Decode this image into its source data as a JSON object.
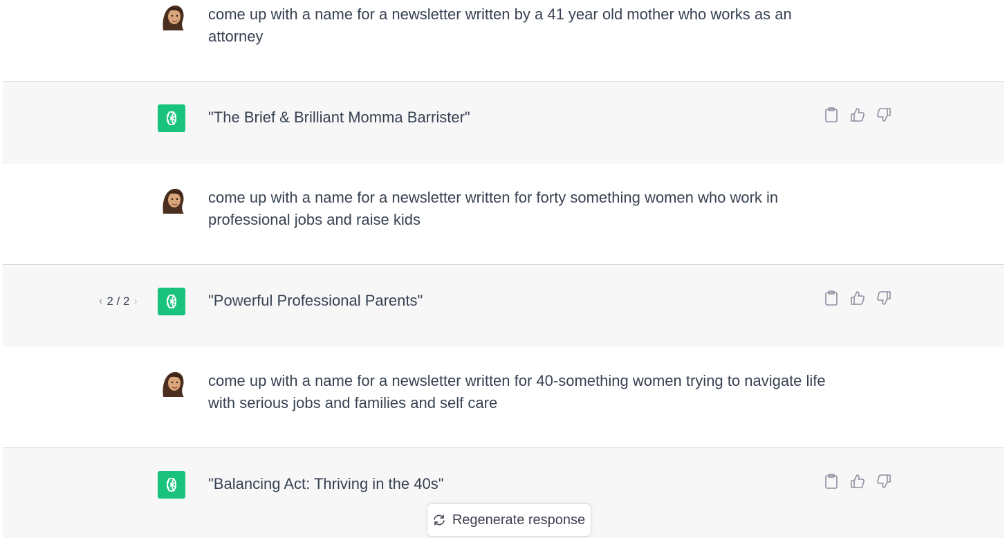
{
  "conversation": [
    {
      "role": "user",
      "text": "come up with a name for a newsletter written by a 41 year old mother who works as an\nattorney"
    },
    {
      "role": "assistant",
      "text": "\"The Brief & Brilliant Momma Barrister\""
    },
    {
      "role": "user",
      "text": "come up with a name for a newsletter written for forty something women who work in\nprofessional jobs and raise kids"
    },
    {
      "role": "assistant",
      "text": "\"Powerful Professional Parents\"",
      "pager": "2 / 2"
    },
    {
      "role": "user",
      "text": "come up with a name for a newsletter written for 40-something women trying to navigate life\nwith serious jobs and families and self care"
    },
    {
      "role": "assistant",
      "text": "\"Balancing Act: Thriving in the 40s\""
    }
  ],
  "regenerate_label": "Regenerate response",
  "icons": {
    "copy": "clipboard-icon",
    "like": "thumbs-up-icon",
    "dislike": "thumbs-down-icon",
    "regenerate": "refresh-icon",
    "assistant_avatar": "openai-logo-icon"
  },
  "colors": {
    "assistant_bg": "#f7f7f8",
    "openai_green": "#19c37d",
    "text": "#374151"
  }
}
